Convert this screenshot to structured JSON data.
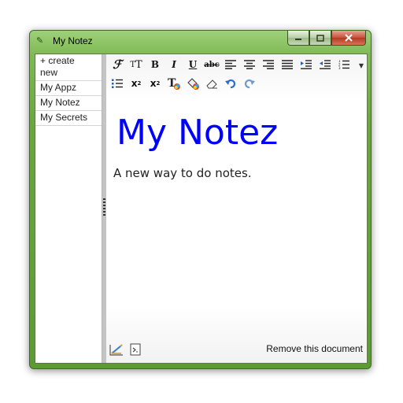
{
  "window": {
    "title": "My Notez"
  },
  "sidebar": {
    "items": [
      {
        "label": "+ create\nnew"
      },
      {
        "label": "My Appz"
      },
      {
        "label": "My Notez"
      },
      {
        "label": "My Secrets"
      }
    ]
  },
  "toolbar": {
    "row1": [
      "font-family-icon",
      "font-size-icon",
      "bold-icon",
      "italic-icon",
      "underline-icon",
      "strikethrough-icon",
      "align-left-icon",
      "align-center-icon",
      "align-right-icon",
      "justify-icon",
      "indent-icon",
      "outdent-icon",
      "numbered-list-icon"
    ],
    "row2": [
      "bulleted-list-icon",
      "superscript-icon",
      "subscript-icon",
      "text-color-icon",
      "fill-color-icon",
      "eraser-icon",
      "undo-icon",
      "redo-icon"
    ]
  },
  "document": {
    "heading": "My Notez",
    "body": "A new way to do notes."
  },
  "footer": {
    "remove_label": "Remove this document"
  }
}
